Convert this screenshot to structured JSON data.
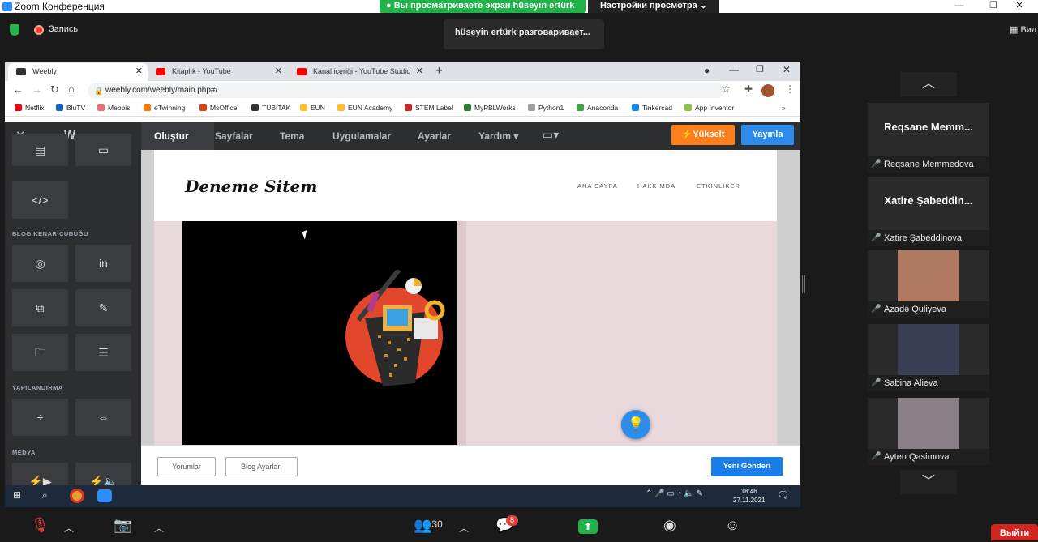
{
  "window": {
    "title": "Zoom Конференция",
    "controls": [
      "—",
      "❐",
      "✕"
    ]
  },
  "share_banner": "Вы просматриваете экран hüseyin ertürk",
  "view_settings": "Настройки просмотра",
  "recording": "Запись",
  "speaking": "hüseyin ertürk разговаривает...",
  "view_button": "Вид",
  "browser": {
    "tabs": [
      {
        "label": "Weebly",
        "active": true,
        "color": "#333"
      },
      {
        "label": "Kitaplık - YouTube",
        "active": false,
        "color": "#ff0000"
      },
      {
        "label": "Kanal içeriği - YouTube Studio",
        "active": false,
        "color": "#ff0000"
      }
    ],
    "url": "weebly.com/weebly/main.php#/",
    "bookmarks": [
      {
        "label": "Netflix",
        "color": "#e50914"
      },
      {
        "label": "BluTV",
        "color": "#1565c0"
      },
      {
        "label": "Mebbis",
        "color": "#e57373"
      },
      {
        "label": "eTwinning",
        "color": "#f57c00"
      },
      {
        "label": "MsOffice",
        "color": "#d84315"
      },
      {
        "label": "TUBITAK",
        "color": "#333333"
      },
      {
        "label": "EUN",
        "color": "#fbc02d"
      },
      {
        "label": "EUN Academy",
        "color": "#fbc02d"
      },
      {
        "label": "STEM Label",
        "color": "#c62828"
      },
      {
        "label": "MyPBLWorks",
        "color": "#2e7d32"
      },
      {
        "label": "Python1",
        "color": "#9e9e9e"
      },
      {
        "label": "Anaconda",
        "color": "#43a047"
      },
      {
        "label": "Tinkercad",
        "color": "#1e88e5"
      },
      {
        "label": "App Inventor",
        "color": "#8bc34a"
      }
    ]
  },
  "weebly": {
    "nav": [
      "Oluştur",
      "Sayfalar",
      "Tema",
      "Uygulamalar",
      "Ayarlar",
      "Yardım ▾"
    ],
    "upgrade": "⚡Yükselt",
    "publish": "Yayınla",
    "sidebar": {
      "code_icon": "</>",
      "section_blog": "BLOG KENAR ÇUBUĞU",
      "section_structure": "YAPILANDIRMA",
      "section_media": "MEDYA"
    },
    "site": {
      "logo": "Deneme Sitem",
      "menu": [
        "ANA SAYFA",
        "HAKKIMDA",
        "ETKINLIKER"
      ]
    },
    "bottom": {
      "comments": "Yorumlar",
      "blog_settings": "Blog Ayarları",
      "new_post": "Yeni Gönderi"
    }
  },
  "taskbar": {
    "time": "18:46",
    "date": "27.11.2021"
  },
  "participants": [
    {
      "big": "Reqsane Memm...",
      "name": "Reqsane Memmedova"
    },
    {
      "big": "Xatire Şabeddin...",
      "name": "Xatire Şabeddinova"
    },
    {
      "name": "Azadə Quliyeva",
      "face": "#b07a62"
    },
    {
      "name": "Sabina Alieva",
      "face": "#3b3f55"
    },
    {
      "name": "Ayten Qasimova",
      "face": "#8a7f86"
    }
  ],
  "meeting": {
    "participants_count": "30",
    "chat_badge": "8",
    "exit": "Выйти"
  }
}
